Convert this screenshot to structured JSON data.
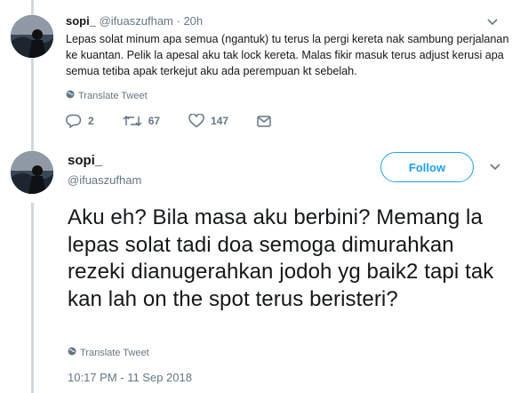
{
  "reply_tweet": {
    "display_name": "sopi_",
    "handle": "@ifuaszufham",
    "time": " · 20h",
    "text": "Lepas solat minum apa semua (ngantuk) tu terus la pergi kereta nak sambung perjalanan ke kuantan. Pelik la apesal aku tak lock kereta. Malas fikir masuk terus adjust kerusi apa semua tetiba apak terkejut aku ada perempuan kt sebelah.",
    "translate_label": "Translate Tweet",
    "reply_count": "2",
    "retweet_count": "67",
    "like_count": "147"
  },
  "main_tweet": {
    "display_name": "sopi_",
    "handle": "@ifuaszufham",
    "follow_label": "Follow",
    "text": "Aku eh? Bila masa aku berbini? Memang la lepas solat tadi doa semoga dimurahkan rezeki dianugerahkan jodoh yg baik2 tapi tak kan lah on the spot terus beristeri?",
    "translate_label": "Translate Tweet",
    "timestamp": "10:17 PM - 11 Sep 2018"
  },
  "icons": {
    "reply": "reply-icon",
    "retweet": "retweet-icon",
    "like": "heart-icon",
    "dm": "envelope-icon",
    "globe": "globe-icon",
    "caret": "chevron-down-icon"
  },
  "colors": {
    "accent": "#1da1f2",
    "secondary_text": "#657786",
    "thread_line": "#cfd9de"
  }
}
